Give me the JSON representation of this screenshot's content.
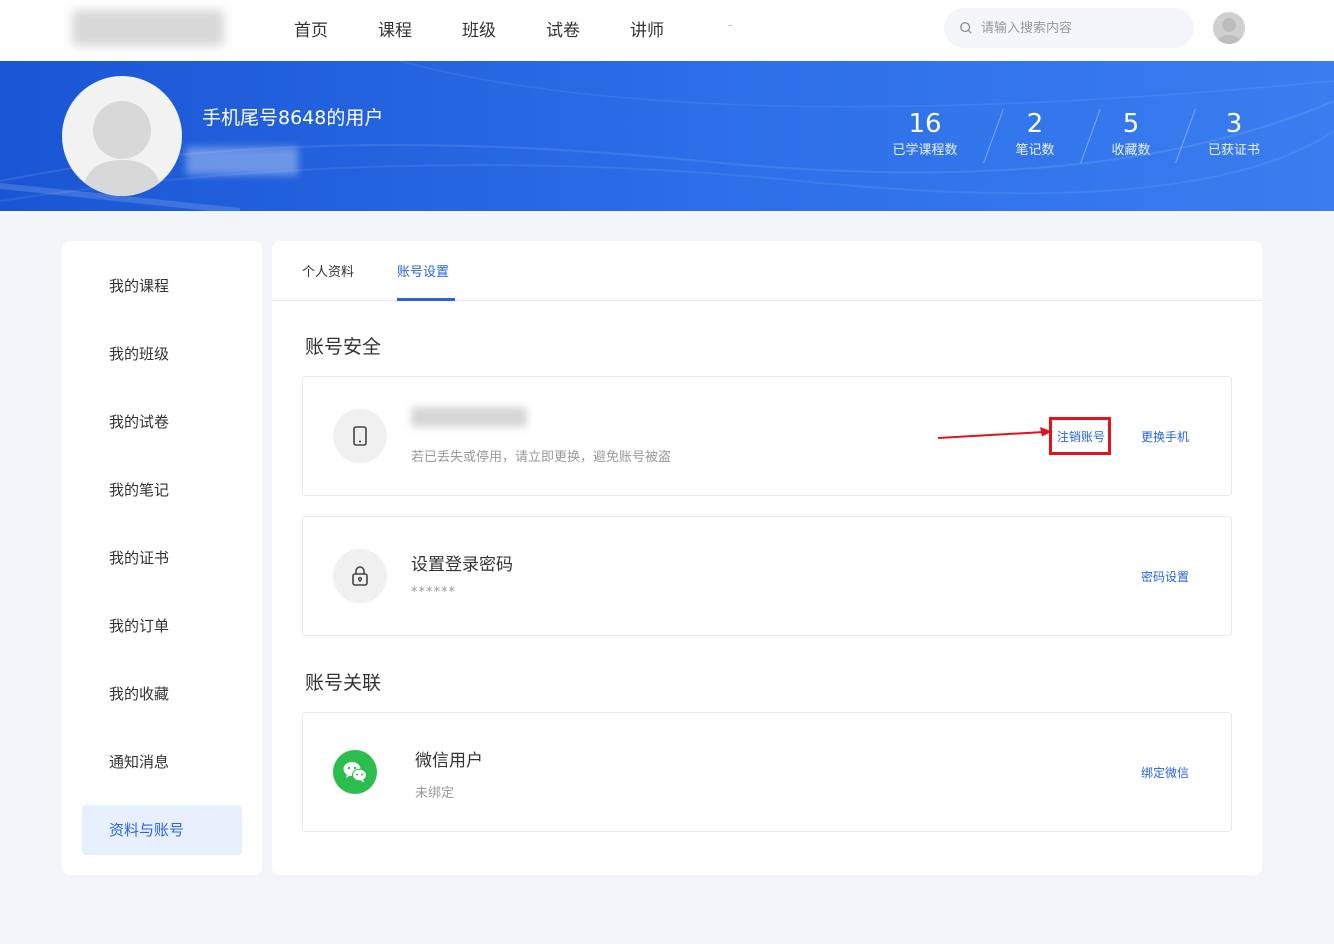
{
  "nav": {
    "items": [
      "首页",
      "课程",
      "班级",
      "试卷",
      "讲师"
    ],
    "dash": "-",
    "search_placeholder": "请输入搜索内容"
  },
  "profile": {
    "username": "手机尾号8648的用户",
    "stats": [
      {
        "value": "16",
        "label": "已学课程数"
      },
      {
        "value": "2",
        "label": "笔记数"
      },
      {
        "value": "5",
        "label": "收藏数"
      },
      {
        "value": "3",
        "label": "已获证书"
      }
    ]
  },
  "sidebar": {
    "items": [
      {
        "label": "我的课程"
      },
      {
        "label": "我的班级"
      },
      {
        "label": "我的试卷"
      },
      {
        "label": "我的笔记"
      },
      {
        "label": "我的证书"
      },
      {
        "label": "我的订单"
      },
      {
        "label": "我的收藏"
      },
      {
        "label": "通知消息"
      },
      {
        "label": "资料与账号",
        "active": true
      }
    ]
  },
  "tabs": [
    {
      "label": "个人资料"
    },
    {
      "label": "账号设置",
      "active": true
    }
  ],
  "security": {
    "title": "账号安全",
    "phone_card": {
      "desc": "若已丢失或停用，请立即更换，避免账号被盗",
      "cancel_link": "注销账号",
      "change_link": "更换手机"
    },
    "password_card": {
      "title": "设置登录密码",
      "value": "******",
      "link": "密码设置"
    }
  },
  "linked": {
    "title": "账号关联",
    "wechat_card": {
      "title": "微信用户",
      "status": "未绑定",
      "link": "绑定微信"
    }
  },
  "colors": {
    "accent": "#2963e0",
    "banner": "#2c6fe8",
    "annotation": "#e0141e",
    "wechat": "#2bbd4e"
  },
  "icons": [
    "search-icon",
    "phone-icon",
    "lock-icon",
    "wechat-icon",
    "user-avatar-icon"
  ]
}
